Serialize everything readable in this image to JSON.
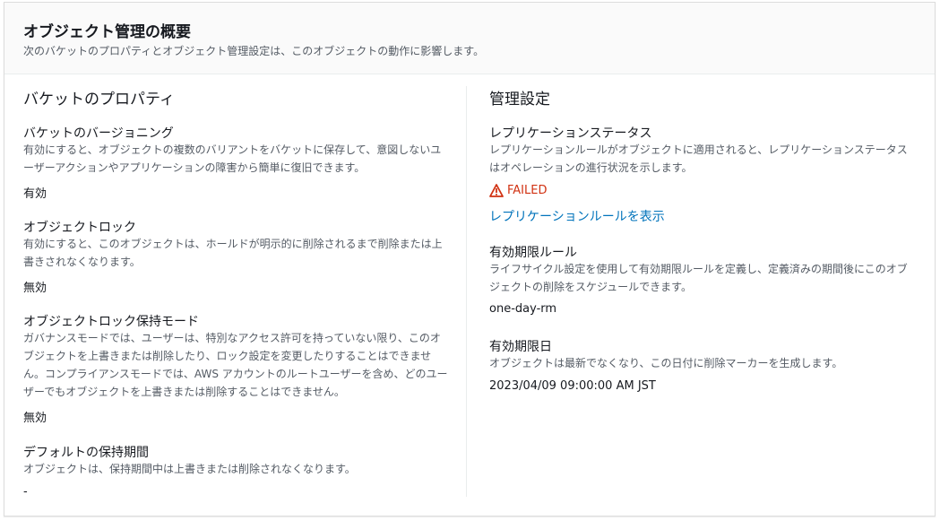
{
  "header": {
    "title": "オブジェクト管理の概要",
    "description": "次のバケットのプロパティとオブジェクト管理設定は、このオブジェクトの動作に影響します。"
  },
  "bucket_properties": {
    "title": "バケットのプロパティ",
    "versioning": {
      "label": "バケットのバージョニング",
      "desc_lines": [
        "有効にすると、オブジェクトの複数のバリアントをバケットに保存して、意図しないユ",
        "ーザーアクションやアプリケーションの障害から簡単に復旧できます。"
      ],
      "value": "有効"
    },
    "object_lock": {
      "label": "オブジェクトロック",
      "desc_lines": [
        "有効にすると、このオブジェクトは、ホールドが明示的に削除されるまで削除または上",
        "書きされなくなります。"
      ],
      "value": "無効"
    },
    "retention_mode": {
      "label": "オブジェクトロック保持モード",
      "desc_lines": [
        "ガバナンスモードでは、ユーザーは、特別なアクセス許可を持っていない限り、このオ",
        "ブジェクトを上書きまたは削除したり、ロック設定を変更したりすることはできませ",
        "ん。コンプライアンスモードでは、AWS アカウントのルートユーザーを含め、どのユー",
        "ザーでもオブジェクトを上書きまたは削除することはできません。"
      ],
      "value": "無効"
    },
    "default_retention": {
      "label": "デフォルトの保持期間",
      "desc_lines": [
        "オブジェクトは、保持期間中は上書きまたは削除されなくなります。"
      ],
      "value": "-"
    }
  },
  "management": {
    "title": "管理設定",
    "replication": {
      "label": "レプリケーションステータス",
      "desc_lines": [
        "レプリケーションルールがオブジェクトに適用されると、レプリケーションステータス",
        "はオペレーションの進行状況を示します。"
      ],
      "status": "FAILED",
      "status_color": "#d13212",
      "status_icon": "warning-icon",
      "link": "レプリケーションルールを表示"
    },
    "expiration_rule": {
      "label": "有効期限ルール",
      "desc_lines": [
        "ライフサイクル設定を使用して有効期限ルールを定義し、定義済みの期間後にこのオブ",
        "ジェクトの削除をスケジュールできます。"
      ],
      "value": "one-day-rm"
    },
    "expiration_date": {
      "label": "有効期限日",
      "desc_lines": [
        "オブジェクトは最新でなくなり、この日付に削除マーカーを生成します。"
      ],
      "value": "2023/04/09 09:00:00 AM JST"
    }
  },
  "colors": {
    "link": "#0073bb",
    "error": "#d13212",
    "text": "#16191f",
    "secondary_text": "#545b64"
  }
}
